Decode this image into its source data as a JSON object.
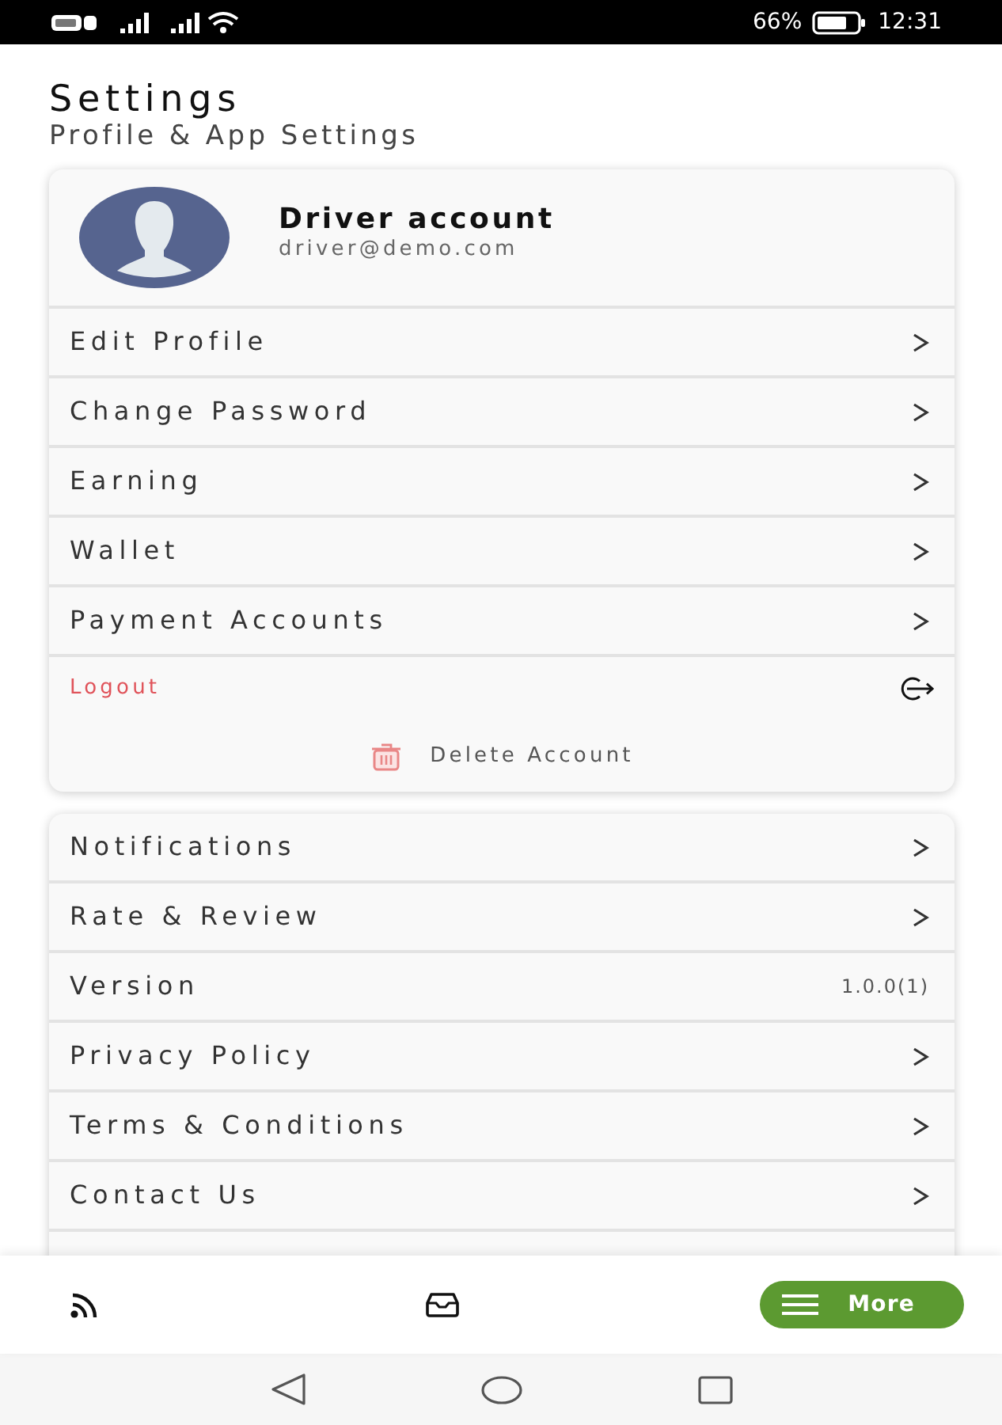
{
  "status_bar": {
    "battery": "66%",
    "time": "12:31"
  },
  "header": {
    "title": "Settings",
    "subtitle": "Profile & App Settings"
  },
  "profile": {
    "name": "Driver account",
    "email": "driver@demo.com"
  },
  "account_menu": [
    {
      "kind": "link",
      "label": "Edit Profile"
    },
    {
      "kind": "link",
      "label": "Change Password"
    },
    {
      "kind": "link",
      "label": "Earning"
    },
    {
      "kind": "link",
      "label": "Wallet"
    },
    {
      "kind": "link",
      "label": "Payment Accounts"
    },
    {
      "kind": "logout",
      "label": "Logout"
    },
    {
      "kind": "delete",
      "label": "Delete Account"
    }
  ],
  "app_menu": [
    {
      "kind": "link",
      "label": "Notifications"
    },
    {
      "kind": "link",
      "label": "Rate & Review"
    },
    {
      "kind": "value",
      "label": "Version",
      "value": "1.0.0(1)"
    },
    {
      "kind": "link",
      "label": "Privacy Policy"
    },
    {
      "kind": "link",
      "label": "Terms & Conditions"
    },
    {
      "kind": "link",
      "label": "Contact Us"
    }
  ],
  "bottom_nav": [
    {
      "kind": "feed",
      "selected": false
    },
    {
      "kind": "inbox",
      "selected": false
    },
    {
      "kind": "menu",
      "label": "More",
      "selected": true
    }
  ]
}
